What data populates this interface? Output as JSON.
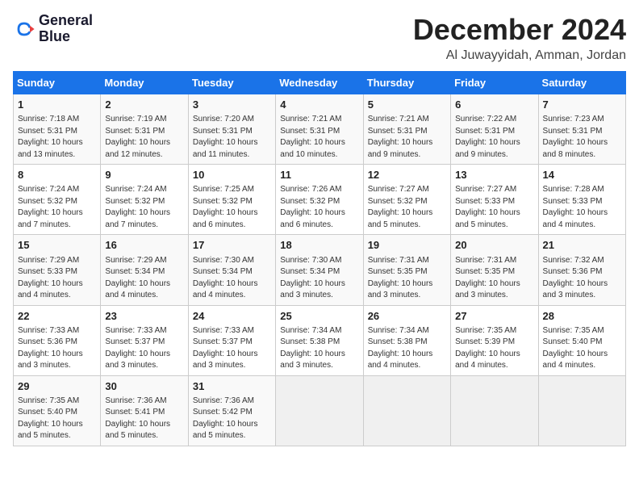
{
  "logo": {
    "line1": "General",
    "line2": "Blue"
  },
  "title": "December 2024",
  "location": "Al Juwayyidah, Amman, Jordan",
  "weekdays": [
    "Sunday",
    "Monday",
    "Tuesday",
    "Wednesday",
    "Thursday",
    "Friday",
    "Saturday"
  ],
  "weeks": [
    [
      {
        "day": "1",
        "sunrise": "7:18 AM",
        "sunset": "5:31 PM",
        "daylight": "10 hours and 13 minutes."
      },
      {
        "day": "2",
        "sunrise": "7:19 AM",
        "sunset": "5:31 PM",
        "daylight": "10 hours and 12 minutes."
      },
      {
        "day": "3",
        "sunrise": "7:20 AM",
        "sunset": "5:31 PM",
        "daylight": "10 hours and 11 minutes."
      },
      {
        "day": "4",
        "sunrise": "7:21 AM",
        "sunset": "5:31 PM",
        "daylight": "10 hours and 10 minutes."
      },
      {
        "day": "5",
        "sunrise": "7:21 AM",
        "sunset": "5:31 PM",
        "daylight": "10 hours and 9 minutes."
      },
      {
        "day": "6",
        "sunrise": "7:22 AM",
        "sunset": "5:31 PM",
        "daylight": "10 hours and 9 minutes."
      },
      {
        "day": "7",
        "sunrise": "7:23 AM",
        "sunset": "5:31 PM",
        "daylight": "10 hours and 8 minutes."
      }
    ],
    [
      {
        "day": "8",
        "sunrise": "7:24 AM",
        "sunset": "5:32 PM",
        "daylight": "10 hours and 7 minutes."
      },
      {
        "day": "9",
        "sunrise": "7:24 AM",
        "sunset": "5:32 PM",
        "daylight": "10 hours and 7 minutes."
      },
      {
        "day": "10",
        "sunrise": "7:25 AM",
        "sunset": "5:32 PM",
        "daylight": "10 hours and 6 minutes."
      },
      {
        "day": "11",
        "sunrise": "7:26 AM",
        "sunset": "5:32 PM",
        "daylight": "10 hours and 6 minutes."
      },
      {
        "day": "12",
        "sunrise": "7:27 AM",
        "sunset": "5:32 PM",
        "daylight": "10 hours and 5 minutes."
      },
      {
        "day": "13",
        "sunrise": "7:27 AM",
        "sunset": "5:33 PM",
        "daylight": "10 hours and 5 minutes."
      },
      {
        "day": "14",
        "sunrise": "7:28 AM",
        "sunset": "5:33 PM",
        "daylight": "10 hours and 4 minutes."
      }
    ],
    [
      {
        "day": "15",
        "sunrise": "7:29 AM",
        "sunset": "5:33 PM",
        "daylight": "10 hours and 4 minutes."
      },
      {
        "day": "16",
        "sunrise": "7:29 AM",
        "sunset": "5:34 PM",
        "daylight": "10 hours and 4 minutes."
      },
      {
        "day": "17",
        "sunrise": "7:30 AM",
        "sunset": "5:34 PM",
        "daylight": "10 hours and 4 minutes."
      },
      {
        "day": "18",
        "sunrise": "7:30 AM",
        "sunset": "5:34 PM",
        "daylight": "10 hours and 3 minutes."
      },
      {
        "day": "19",
        "sunrise": "7:31 AM",
        "sunset": "5:35 PM",
        "daylight": "10 hours and 3 minutes."
      },
      {
        "day": "20",
        "sunrise": "7:31 AM",
        "sunset": "5:35 PM",
        "daylight": "10 hours and 3 minutes."
      },
      {
        "day": "21",
        "sunrise": "7:32 AM",
        "sunset": "5:36 PM",
        "daylight": "10 hours and 3 minutes."
      }
    ],
    [
      {
        "day": "22",
        "sunrise": "7:33 AM",
        "sunset": "5:36 PM",
        "daylight": "10 hours and 3 minutes."
      },
      {
        "day": "23",
        "sunrise": "7:33 AM",
        "sunset": "5:37 PM",
        "daylight": "10 hours and 3 minutes."
      },
      {
        "day": "24",
        "sunrise": "7:33 AM",
        "sunset": "5:37 PM",
        "daylight": "10 hours and 3 minutes."
      },
      {
        "day": "25",
        "sunrise": "7:34 AM",
        "sunset": "5:38 PM",
        "daylight": "10 hours and 3 minutes."
      },
      {
        "day": "26",
        "sunrise": "7:34 AM",
        "sunset": "5:38 PM",
        "daylight": "10 hours and 4 minutes."
      },
      {
        "day": "27",
        "sunrise": "7:35 AM",
        "sunset": "5:39 PM",
        "daylight": "10 hours and 4 minutes."
      },
      {
        "day": "28",
        "sunrise": "7:35 AM",
        "sunset": "5:40 PM",
        "daylight": "10 hours and 4 minutes."
      }
    ],
    [
      {
        "day": "29",
        "sunrise": "7:35 AM",
        "sunset": "5:40 PM",
        "daylight": "10 hours and 5 minutes."
      },
      {
        "day": "30",
        "sunrise": "7:36 AM",
        "sunset": "5:41 PM",
        "daylight": "10 hours and 5 minutes."
      },
      {
        "day": "31",
        "sunrise": "7:36 AM",
        "sunset": "5:42 PM",
        "daylight": "10 hours and 5 minutes."
      },
      null,
      null,
      null,
      null
    ]
  ]
}
